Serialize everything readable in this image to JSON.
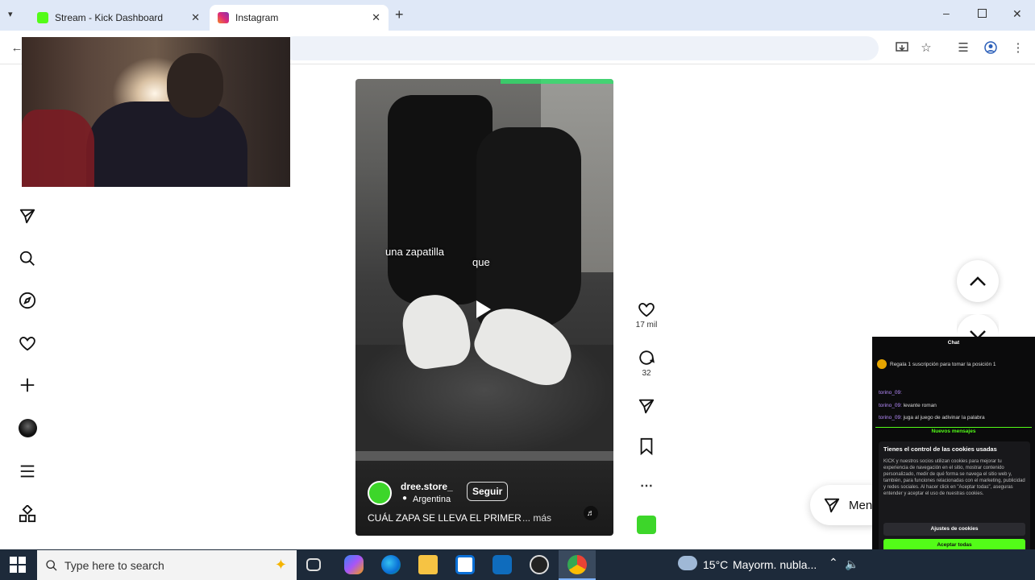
{
  "browser": {
    "tabs": [
      {
        "title": "Stream - Kick Dashboard",
        "favicon_color": "#53fc18",
        "active": false
      },
      {
        "title": "Instagram",
        "favicon_color": "#e1306c",
        "active": true
      }
    ],
    "new_tab_symbol": "+",
    "window_controls": [
      "minimize-icon",
      "maximize-icon",
      "close-icon"
    ]
  },
  "sidebar": {
    "icons": [
      "send-icon",
      "search-icon",
      "explore-icon",
      "heart-icon",
      "create-icon",
      "avatar",
      "menu-icon",
      "apps-icon"
    ]
  },
  "reel": {
    "caption_words": [
      "una zapatilla",
      "que"
    ],
    "account_name": "dree.store_",
    "location": "Argentina",
    "follow_label": "Seguir",
    "description": "CUÁL ZAPA SE LLEVA EL PRIMER",
    "more_label": "... más"
  },
  "actions": {
    "likes": "17 mil",
    "comments": "32"
  },
  "messages_button_label": "Men",
  "chat": {
    "title": "Chat",
    "pinned": "Regala 1 suscripción para tomar la posición 1",
    "messages": [
      {
        "user": "torino_09:",
        "text": ""
      },
      {
        "user": "torino_09:",
        "text": "levante roman"
      },
      {
        "user": "torino_09:",
        "text": "juga al juego de adivinar la palabra"
      }
    ],
    "new_messages": "Nuevos mensajes",
    "cookies_title": "Tienes el control de las cookies usadas",
    "cookies_body": "KICK y nuestros socios utilizan cookies para mejorar tu experiencia de navegación en el sitio, mostrar contenido personalizado, medir de qué forma se navega el sitio web y, también, para funciones relacionadas con el marketing, publicidad y redes sociales. Al hacer click en \"Aceptar todas\", aseguras entender y aceptar el uso de nuestras cookies.",
    "settings_button": "Ajustes de cookies",
    "accept_button": "Aceptar todas"
  },
  "taskbar": {
    "search_placeholder": "Type here to search",
    "weather_temp": "15°C",
    "weather_text": "Mayorm. nubla..."
  },
  "colors": {
    "kick_green": "#53fc18",
    "instagram_pink": "#e1306c",
    "taskbar_bg": "#1d2a3a"
  }
}
